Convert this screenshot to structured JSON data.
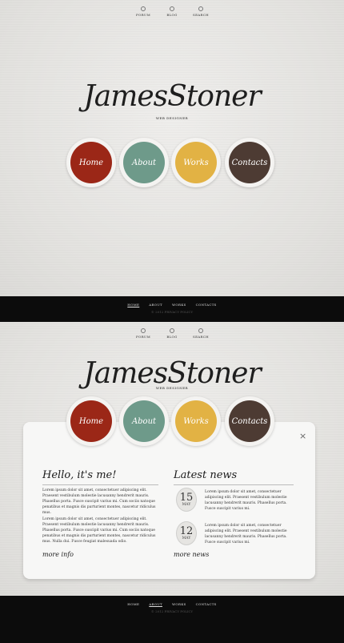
{
  "top_nav": [
    "FORUM",
    "BLOG",
    "SEARCH"
  ],
  "logo": "JamesStoner",
  "tagline": "WEB DESIGNER",
  "circles": [
    {
      "label": "Home",
      "color": "#9b2717"
    },
    {
      "label": "About",
      "color": "#6e9a8a"
    },
    {
      "label": "Works",
      "color": "#e2b244"
    },
    {
      "label": "Contacts",
      "color": "#4d3b33"
    }
  ],
  "footer_nav": [
    "HOME",
    "ABOUT",
    "WORKS",
    "CONTACTS"
  ],
  "footer_copy": "© 2012 PRIVACY POLICY",
  "footer2_copy": "© 2012 PRIVACY POLICY",
  "panel": {
    "close_label": "×",
    "left": {
      "title": "Hello, it's me!",
      "para1": "Lorem ipsum dolor sit amet, consectetuer adipiscing elit. Praesent vestibulum molestie lacusanny hendrerit mauris. Phasellus porta. Fusce suscipit varius mi. Cum sociis natoque penatibus et magnis dis parturient montes, nascetur ridiculus mus.",
      "para2": "Lorem ipsum dolor sit amet, consectetuer adipiscing elit. Praesent vestibulum molestie lacusanny hendrerit mauris. Phasellus porta. Fusce suscipit varius mi. Cum sociis natoque penatibus et magnis dis parturient montes, nascetur ridiculus mus. Nulla dui. Fusce feugiat malesuada odio.",
      "more": "more info"
    },
    "right": {
      "title": "Latest news",
      "news": [
        {
          "day": "15",
          "month": "MAY",
          "text": "Lorem ipsum dolor sit amet, consectetuer adipiscing elit. Praesent vestibulum molestie lacusanny hendrerit mauris. Phasellus porta. Fusce suscipit varius mi."
        },
        {
          "day": "12",
          "month": "MAY",
          "text": "Lorem ipsum dolor sit amet, consectetuer adipiscing elit. Praesent vestibulum molestie lacusanny hendrerit mauris. Phasellus porta. Fusce suscipit varius mi."
        }
      ],
      "more": "more news"
    }
  }
}
